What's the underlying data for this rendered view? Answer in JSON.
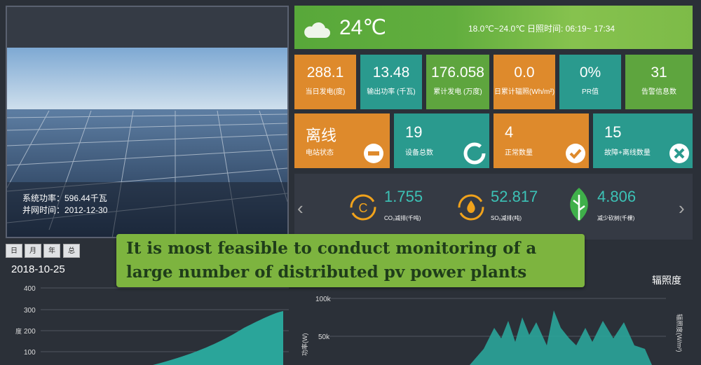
{
  "station": {
    "system_power": "系统功率：596.44千瓦",
    "grid_time": "并网时间：2012-12-30"
  },
  "weather": {
    "temp": "24℃",
    "range": "18.0℃~24.0℃  日照时间: 06:19~ 17:34"
  },
  "tiles": [
    {
      "value": "288.1",
      "label": "当日发电(度)"
    },
    {
      "value": "13.48",
      "label": "输出功率 (千瓦)"
    },
    {
      "value": "176.058",
      "label": "累计发电 (万度)"
    },
    {
      "value": "0.0",
      "label": "日累计辐照(Wh/m²)"
    },
    {
      "value": "0%",
      "label": "PR值"
    },
    {
      "value": "31",
      "label": "告警信息数"
    }
  ],
  "big_tiles": [
    {
      "value": "离线",
      "label": "电站状态"
    },
    {
      "value": "19",
      "label": "设备总数"
    },
    {
      "value": "4",
      "label": "正常数量"
    },
    {
      "value": "15",
      "label": "故障+离线数量"
    }
  ],
  "emissions": [
    {
      "value": "1.755",
      "label": "CO₂减排(千吨)"
    },
    {
      "value": "52.817",
      "label": "SO₂减排(吨)"
    },
    {
      "value": "4.806",
      "label": "减少砍树(千棵)"
    }
  ],
  "period_buttons": [
    "日",
    "月",
    "年",
    "总"
  ],
  "date": "2018-10-25",
  "left_chart": {
    "ylabel": "度",
    "ticks": [
      "400",
      "300",
      "200",
      "100"
    ]
  },
  "right_chart": {
    "title": "辐照度",
    "ylabel": "功率(W)",
    "ylabel_right": "辐照度(W/m²)",
    "ticks": [
      "100k",
      "50k"
    ]
  },
  "banner": "It is most feasible to conduct monitoring of a large number of distributed pv power plants",
  "nav": {
    "prev": "‹",
    "next": "›"
  }
}
